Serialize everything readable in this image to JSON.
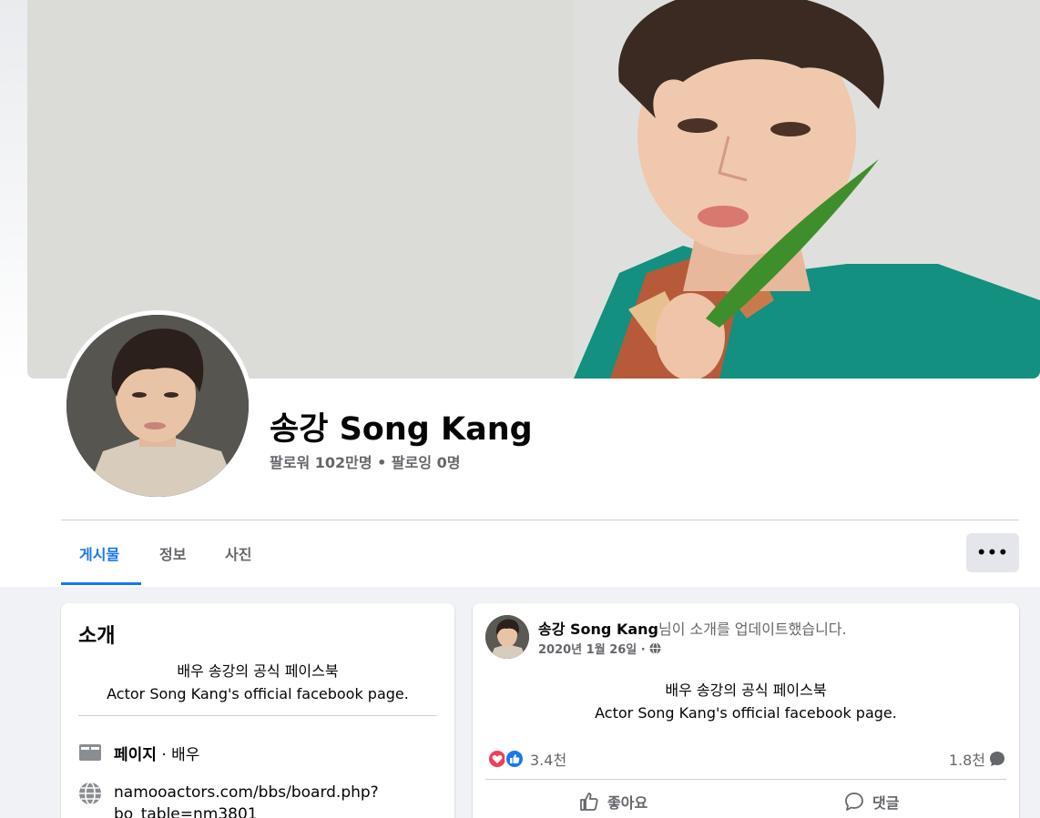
{
  "page": {
    "name": "송강 Song Kang",
    "followers_line": "팔로워 102만명 • 팔로잉 0명"
  },
  "tabs": [
    {
      "label": "게시물",
      "active": true
    },
    {
      "label": "정보",
      "active": false
    },
    {
      "label": "사진",
      "active": false
    }
  ],
  "more_button": {
    "label": "•••"
  },
  "intro": {
    "title": "소개",
    "bio_ko": "배우 송강의 공식 페이스북",
    "bio_en": "Actor Song Kang's official facebook page.",
    "category_label": "페이지",
    "category_value": " · 배우",
    "website_line1": "namooactors.com/bbs/board.php?",
    "website_line2": "bo_table=nm3801"
  },
  "post": {
    "author": "송강 Song Kang",
    "action_text": "님이 소개를 업데이트했습니다.",
    "date": "2020년 1월 26일 ·",
    "text_ko": "배우 송강의 공식 페이스북",
    "text_en": "Actor Song Kang's official facebook page.",
    "reaction_count": "3.4천",
    "comment_count": "1.8천",
    "like_label": "좋아요",
    "comment_label": "댓글"
  },
  "colors": {
    "accent": "#1877f2",
    "secondary_text": "#65676b",
    "background": "#f0f2f5",
    "love_reaction": "#f33e58",
    "like_reaction": "#1877f2"
  },
  "icons": {
    "category": "page-flag-icon",
    "website": "globe-icon",
    "privacy": "globe-small-icon",
    "like": "thumbs-up-icon",
    "comment": "speech-bubble-icon"
  }
}
